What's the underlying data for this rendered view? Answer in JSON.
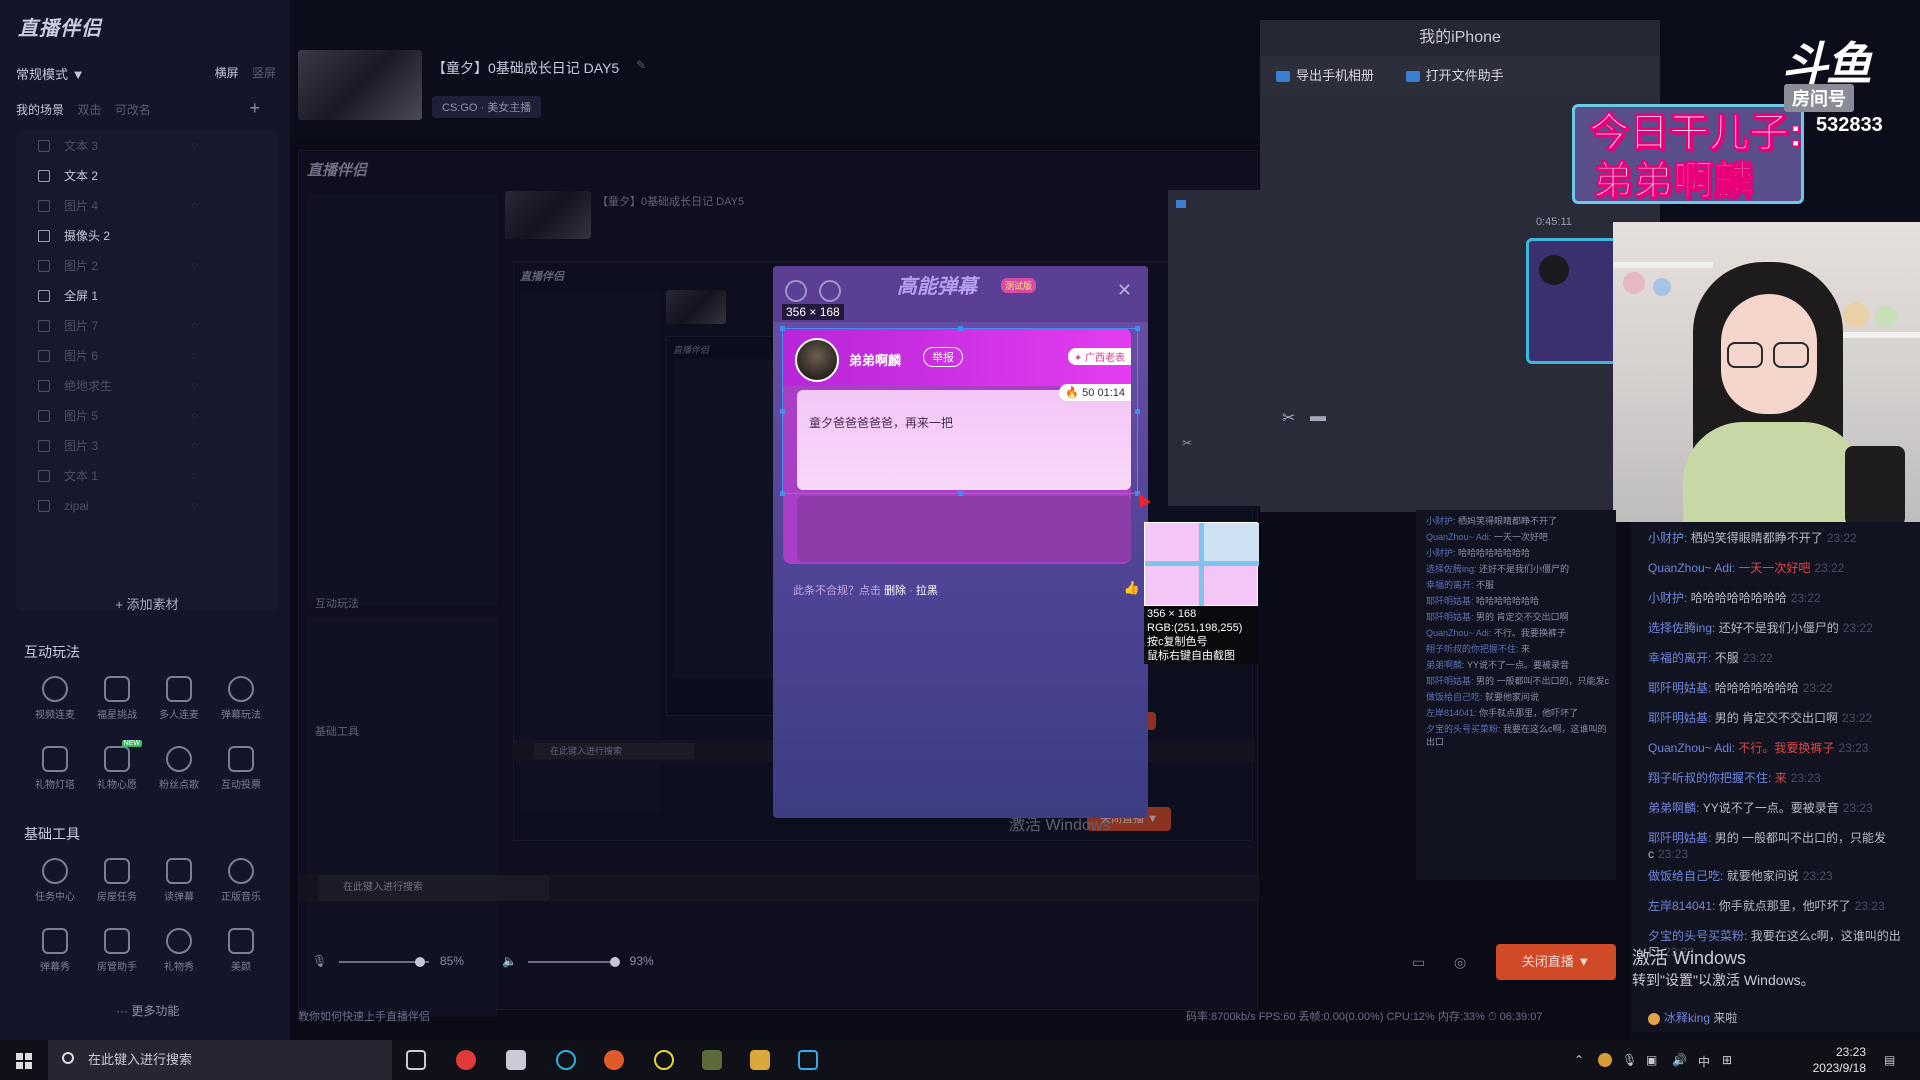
{
  "app": {
    "logo": "直播伴侣",
    "mode": "常规模式 ▼",
    "orient_h": "横屏",
    "orient_v": "竖屏",
    "scene_tabs": [
      "我的场景",
      "双击",
      "可改名"
    ],
    "add": "+",
    "scenes": [
      {
        "label": "文本 3",
        "on": false
      },
      {
        "label": "文本 2",
        "on": true
      },
      {
        "label": "图片 4",
        "on": false
      },
      {
        "label": "摄像头 2",
        "on": true
      },
      {
        "label": "图片 2",
        "on": false
      },
      {
        "label": "全屏 1",
        "on": true
      },
      {
        "label": "图片 7",
        "on": false
      },
      {
        "label": "图片 6",
        "on": false
      },
      {
        "label": "绝地求生",
        "on": false
      },
      {
        "label": "图片 5",
        "on": false
      },
      {
        "label": "图片 3",
        "on": false
      },
      {
        "label": "文本 1",
        "on": false
      },
      {
        "label": "zipai",
        "on": false
      }
    ],
    "add_material": "+ 添加素材",
    "interactive_title": "互动玩法",
    "interactive_tools": [
      "视频连麦",
      "福星挑战",
      "多人连麦",
      "弹幕玩法",
      "礼物灯塔",
      "礼物心愿",
      "粉丝点歌",
      "互动投票"
    ],
    "new_badge": "NEW",
    "basic_title": "基础工具",
    "basic_tools": [
      "任务中心",
      "房屋任务",
      "读弹幕",
      "正版音乐",
      "弹幕秀",
      "房管助手",
      "礼物秀",
      "美颜"
    ],
    "more": "··· 更多功能",
    "tip": "教你如何快速上手直播伴侣",
    "mic_level": "85%",
    "speaker_level": "93%",
    "stop_live": "关闭直播 ▼",
    "status": "码率:8700kb/s   FPS:60   丢帧:0.00(0.00%)   CPU:12%   内存:33%   ⏱ 06:39:07"
  },
  "stream": {
    "title": "【童夕】0基础成长日记 DAY5",
    "category": "CS:GO · 美女主播"
  },
  "phone_window": {
    "title": "我的iPhone",
    "export_album": "导出手机相册",
    "open_assistant": "打开文件助手",
    "time": "0:45:11"
  },
  "overlay": {
    "banner_line1": "今日干儿子:",
    "banner_line2": "弟弟啊麟",
    "platform": "斗鱼",
    "room_label": "房间号",
    "room_no": "532833"
  },
  "popup": {
    "title": "高能弹幕",
    "badge": "测试版",
    "close": "✕",
    "user": "弟弟啊麟",
    "report": "举报",
    "region": "✦ 广西老表",
    "coin": "🔥 50  01:14",
    "message": "童夕爸爸爸爸爸，再来一把",
    "footer_prefix": "此条不合规？点击",
    "footer_delete": "删除",
    "footer_sep": "·",
    "footer_pull": "拉黑",
    "like": "👍"
  },
  "capture": {
    "size": "356 × 168",
    "info_size": "356 × 168",
    "rgb": "RGB:(251,198,255)",
    "hint1": "按c复制色号",
    "hint2": "鼠标右键自由截图"
  },
  "chat": [
    {
      "user": "小财护:",
      "text": "栖妈笑得眼睛都睁不开了",
      "time": "23:22"
    },
    {
      "user": "QuanZhou~ Adi:",
      "text": "一天一次好吧",
      "time": "23:22",
      "red": true
    },
    {
      "user": "小财护:",
      "text": "哈哈哈哈哈哈哈哈",
      "time": "23:22"
    },
    {
      "user": "选择佐腾ing:",
      "text": "还好不是我们小僵尸的",
      "time": "23:22"
    },
    {
      "user": "幸福的离开:",
      "text": "不服",
      "time": "23:22"
    },
    {
      "user": "耶阡明姑基:",
      "text": "哈哈哈哈哈哈哈",
      "time": "23:22"
    },
    {
      "user": "耶阡明姑基:",
      "text": "男的 肯定交不交出口啊",
      "time": "23:22"
    },
    {
      "user": "QuanZhou~ Adi:",
      "text": "不行。我要换裤子",
      "time": "23:23",
      "red": true
    },
    {
      "user": "翔子听叔的你把握不住:",
      "text": "来",
      "time": "23:23",
      "red": true
    },
    {
      "user": "弟弟啊麟:",
      "text": "YY说不了一点。要被录音",
      "time": "23:23"
    },
    {
      "user": "耶阡明姑基:",
      "text": "男的 一般都叫不出口的，只能发c",
      "time": "23:23"
    },
    {
      "user": "做饭给自己吃:",
      "text": "就要他家问说",
      "time": "23:23"
    },
    {
      "user": "左岸814041:",
      "text": "你手就点那里，他吓坏了",
      "time": "23:23"
    },
    {
      "user": "夕宝的头号买菜粉:",
      "text": "我要在这么c啊，这谁叫的出口",
      "time": "23:23"
    }
  ],
  "chat_last": {
    "user": "冰释king",
    "text": "来啦"
  },
  "activate": {
    "line1": "激活 Windows",
    "line2": "转到\"设置\"以激活 Windows。",
    "nested_line": "激活 Windows"
  },
  "taskbar": {
    "search_placeholder": "在此键入进行搜索",
    "tray_lang": "中",
    "time": "23:23",
    "date": "2023/9/18"
  },
  "colors": {
    "accent_red": "#d14a28",
    "popup_purple": "#a83fc4",
    "selection_blue": "#3f8ef0"
  }
}
